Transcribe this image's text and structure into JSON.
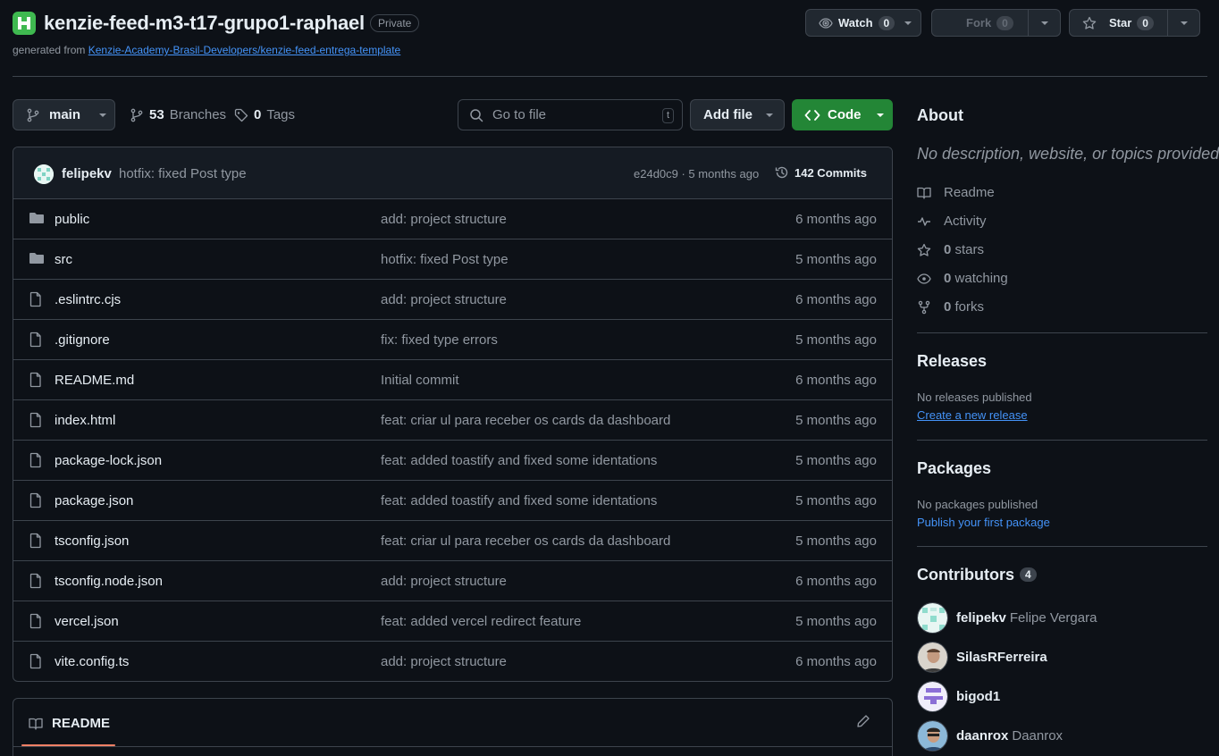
{
  "repo": {
    "name": "kenzie-feed-m3-t17-grupo1-raphael",
    "visibility": "Private",
    "generated_prefix": "generated from",
    "template": "Kenzie-Academy-Brasil-Developers/kenzie-feed-entrega-template"
  },
  "actions": {
    "watch_label": "Watch",
    "watch_count": "0",
    "fork_label": "Fork",
    "fork_count": "0",
    "star_label": "Star",
    "star_count": "0"
  },
  "toolbar": {
    "branch": "main",
    "branches_count": "53",
    "branches_label": "Branches",
    "tags_count": "0",
    "tags_label": "Tags",
    "search_placeholder": "Go to file",
    "search_key": "t",
    "add_file": "Add file",
    "code": "Code"
  },
  "latest_commit": {
    "author": "felipekv",
    "message": "hotfix: fixed Post type",
    "hash_time": "e24d0c9 · 5 months ago",
    "commits": "142 Commits"
  },
  "files": [
    {
      "type": "dir",
      "name": "public",
      "message": "add: project structure",
      "date": "6 months ago"
    },
    {
      "type": "dir",
      "name": "src",
      "message": "hotfix: fixed Post type",
      "date": "5 months ago"
    },
    {
      "type": "file",
      "name": ".eslintrc.cjs",
      "message": "add: project structure",
      "date": "6 months ago"
    },
    {
      "type": "file",
      "name": ".gitignore",
      "message": "fix: fixed type errors",
      "date": "5 months ago"
    },
    {
      "type": "file",
      "name": "README.md",
      "message": "Initial commit",
      "date": "6 months ago"
    },
    {
      "type": "file",
      "name": "index.html",
      "message": "feat: criar ul para receber os cards da dashboard",
      "date": "5 months ago"
    },
    {
      "type": "file",
      "name": "package-lock.json",
      "message": "feat: added toastify and fixed some identations",
      "date": "5 months ago"
    },
    {
      "type": "file",
      "name": "package.json",
      "message": "feat: added toastify and fixed some identations",
      "date": "5 months ago"
    },
    {
      "type": "file",
      "name": "tsconfig.json",
      "message": "feat: criar ul para receber os cards da dashboard",
      "date": "5 months ago"
    },
    {
      "type": "file",
      "name": "tsconfig.node.json",
      "message": "add: project structure",
      "date": "6 months ago"
    },
    {
      "type": "file",
      "name": "vercel.json",
      "message": "feat: added vercel redirect feature",
      "date": "5 months ago"
    },
    {
      "type": "file",
      "name": "vite.config.ts",
      "message": "add: project structure",
      "date": "6 months ago"
    }
  ],
  "readme": {
    "tab": "README"
  },
  "about": {
    "title": "About",
    "description": "No description, website, or topics provided.",
    "readme": "Readme",
    "activity": "Activity",
    "stars_count": "0",
    "stars_label": "stars",
    "watching_count": "0",
    "watching_label": "watching",
    "forks_count": "0",
    "forks_label": "forks"
  },
  "releases": {
    "title": "Releases",
    "empty": "No releases published",
    "link": "Create a new release"
  },
  "packages": {
    "title": "Packages",
    "empty": "No packages published",
    "link": "Publish your first package"
  },
  "contributors": {
    "title": "Contributors",
    "count": "4",
    "list": [
      {
        "login": "felipekv",
        "name": "Felipe Vergara"
      },
      {
        "login": "SilasRFerreira",
        "name": ""
      },
      {
        "login": "bigod1",
        "name": ""
      },
      {
        "login": "daanrox",
        "name": "Daanrox"
      }
    ]
  },
  "colors": {
    "accent": "#4493f8",
    "code_button": "#238636",
    "logo": "#3fb950"
  }
}
